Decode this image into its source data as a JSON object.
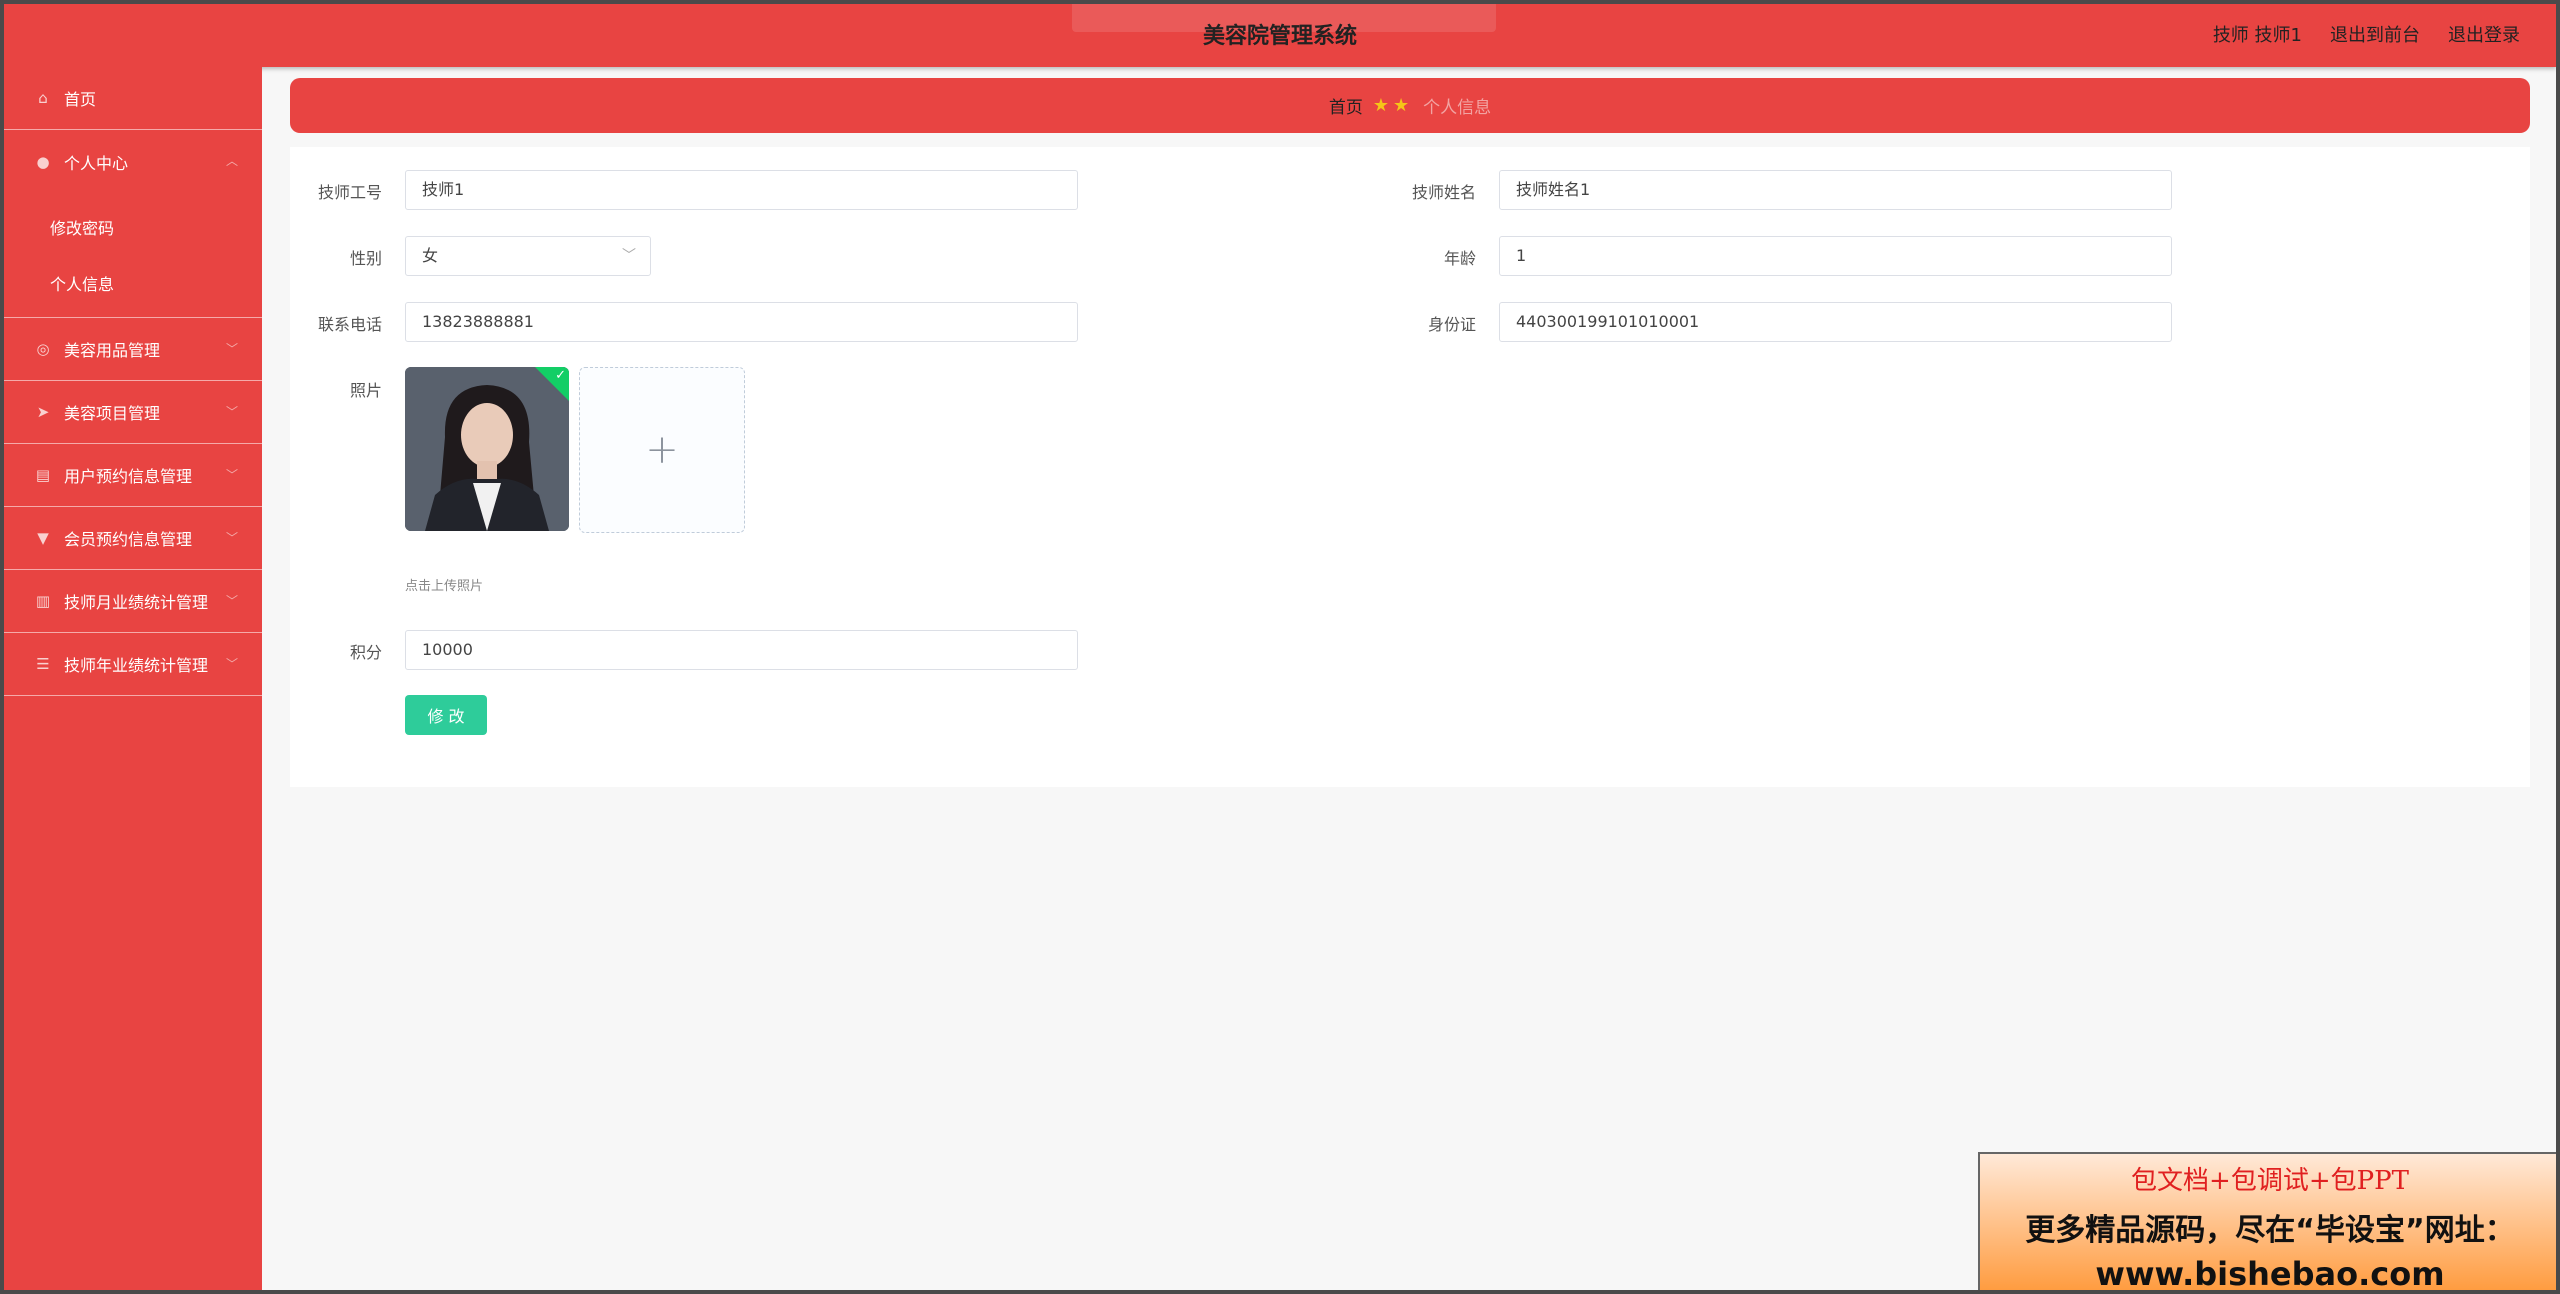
{
  "header": {
    "title": "美容院管理系统",
    "user_label": "技师 技师1",
    "to_front_label": "退出到前台",
    "logout_label": "退出登录"
  },
  "sidebar": {
    "items": [
      {
        "label": "首页",
        "icon": "home-icon"
      },
      {
        "label": "个人中心",
        "icon": "user-icon",
        "children": [
          {
            "label": "修改密码"
          },
          {
            "label": "个人信息"
          }
        ]
      },
      {
        "label": "美容用品管理",
        "icon": "compass-icon"
      },
      {
        "label": "美容项目管理",
        "icon": "send-icon"
      },
      {
        "label": "用户预约信息管理",
        "icon": "clipboard-icon"
      },
      {
        "label": "会员预约信息管理",
        "icon": "trophy-icon"
      },
      {
        "label": "技师月业绩统计管理",
        "icon": "bar-chart-icon"
      },
      {
        "label": "技师年业绩统计管理",
        "icon": "list-icon"
      }
    ]
  },
  "breadcrumb": {
    "home": "首页",
    "current": "个人信息"
  },
  "form": {
    "tech_id": {
      "label": "技师工号",
      "value": "技师1"
    },
    "tech_name": {
      "label": "技师姓名",
      "value": "技师姓名1"
    },
    "gender": {
      "label": "性别",
      "value": "女"
    },
    "age": {
      "label": "年龄",
      "value": "1"
    },
    "phone": {
      "label": "联系电话",
      "value": "13823888881"
    },
    "id_card": {
      "label": "身份证",
      "value": "440300199101010001"
    },
    "photo": {
      "label": "照片",
      "tip": "点击上传照片"
    },
    "points": {
      "label": "积分",
      "value": "10000"
    },
    "submit_label": "修 改"
  },
  "ad": {
    "line1": "包文档+包调试+包PPT",
    "line2": "更多精品源码，尽在“毕设宝”网址：",
    "line3": "www.bishebao.com"
  }
}
